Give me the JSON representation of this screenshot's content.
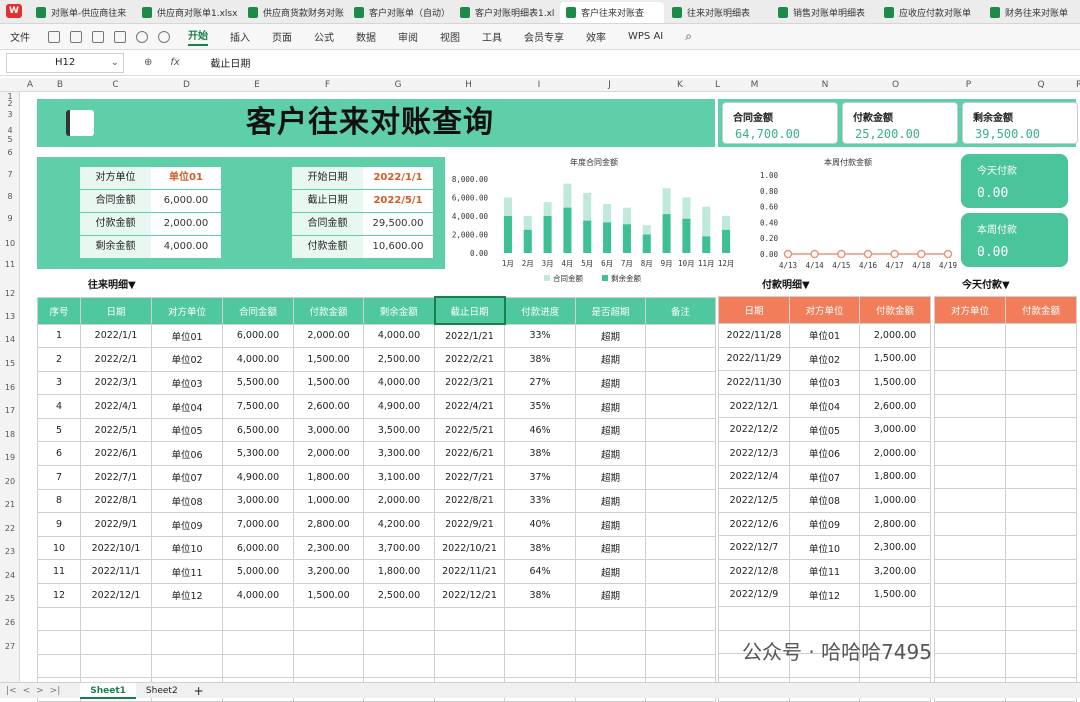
{
  "tabs": [
    {
      "label": "对账单-供应商往来"
    },
    {
      "label": "供应商对账单1.xlsx"
    },
    {
      "label": "供应商货款财务对账"
    },
    {
      "label": "客户对账单（自动）"
    },
    {
      "label": "客户对账明细表1.xl"
    },
    {
      "label": "客户往来对账查"
    },
    {
      "label": "往来对账明细表"
    },
    {
      "label": "销售对账单明细表"
    },
    {
      "label": "应收应付款对账单"
    },
    {
      "label": "财务往来对账单"
    }
  ],
  "ribbon": {
    "file": "文件",
    "items": [
      "开始",
      "插入",
      "页面",
      "公式",
      "数据",
      "审阅",
      "视图",
      "工具",
      "会员专享",
      "效率",
      "WPS AI"
    ],
    "active": "开始"
  },
  "formula_bar": {
    "cell": "H12",
    "content": "截止日期",
    "fx": "fx"
  },
  "columns": [
    "A",
    "B",
    "C",
    "D",
    "E",
    "F",
    "G",
    "H",
    "I",
    "J",
    "K",
    "L",
    "M",
    "N",
    "O",
    "P",
    "Q",
    "R"
  ],
  "rows": [
    "1",
    "2",
    "3",
    "4",
    "5",
    "6",
    "7",
    "8",
    "9",
    "10",
    "11",
    "12",
    "13",
    "14",
    "15",
    "16",
    "17",
    "18",
    "19",
    "20",
    "21",
    "22",
    "23",
    "24",
    "25",
    "26",
    "27"
  ],
  "banner": {
    "title": "客户往来对账查询"
  },
  "kpis": [
    {
      "label": "合同金额",
      "value": "64,700.00"
    },
    {
      "label": "付款金额",
      "value": "25,200.00"
    },
    {
      "label": "剩余金额",
      "value": "39,500.00"
    }
  ],
  "info": {
    "left": [
      {
        "label": "对方单位",
        "value": "单位01"
      },
      {
        "label": "合同金额",
        "value": "6,000.00"
      },
      {
        "label": "付款金额",
        "value": "2,000.00"
      },
      {
        "label": "剩余金额",
        "value": "4,000.00"
      }
    ],
    "right": [
      {
        "label": "开始日期",
        "value": "2022/1/1"
      },
      {
        "label": "截止日期",
        "value": "2022/5/1"
      },
      {
        "label": "合同金额",
        "value": "29,500.00"
      },
      {
        "label": "付款金额",
        "value": "10,600.00"
      }
    ]
  },
  "cards": [
    {
      "label": "今天付款",
      "value": "0.00"
    },
    {
      "label": "本周付款",
      "value": "0.00"
    }
  ],
  "chart_data": [
    {
      "type": "bar",
      "title": "年度合同金额",
      "categories": [
        "1月",
        "2月",
        "3月",
        "4月",
        "5月",
        "6月",
        "7月",
        "8月",
        "9月",
        "10月",
        "11月",
        "12月"
      ],
      "series": [
        {
          "name": "合同金额",
          "values": [
            6000,
            4000,
            5500,
            7500,
            6500,
            5300,
            4900,
            3000,
            7000,
            6000,
            5000,
            4000
          ],
          "color": "#bfe9da"
        },
        {
          "name": "剩余金额",
          "values": [
            4000,
            2500,
            4000,
            4900,
            3500,
            3300,
            3100,
            2000,
            4200,
            3700,
            1800,
            2500
          ],
          "color": "#3ebf95"
        }
      ],
      "ylim": [
        0,
        8000
      ],
      "yticks": [
        "8,000.00",
        "6,000.00",
        "4,000.00",
        "2,000.00",
        "0.00"
      ],
      "legend": "bottom"
    },
    {
      "type": "line",
      "title": "本周付款金额",
      "categories": [
        "4/13",
        "4/14",
        "4/15",
        "4/16",
        "4/17",
        "4/18",
        "4/19"
      ],
      "series": [
        {
          "values": [
            0,
            0,
            0,
            0,
            0,
            0,
            0
          ],
          "color": "#e8967a"
        }
      ],
      "ylim": [
        0,
        1
      ],
      "yticks": [
        "1.00",
        "0.80",
        "0.60",
        "0.40",
        "0.20",
        "0.00"
      ]
    }
  ],
  "sections": {
    "detail": "往来明细▼",
    "payment": "付款明细▼",
    "today": "今天付款▼"
  },
  "main_table": {
    "headers": [
      "序号",
      "日期",
      "对方单位",
      "合同金额",
      "付款金额",
      "剩余金额",
      "截止日期",
      "付款进度",
      "是否超期",
      "备注"
    ],
    "rows": [
      [
        "1",
        "2022/1/1",
        "单位01",
        "6,000.00",
        "2,000.00",
        "4,000.00",
        "2022/1/21",
        "33%",
        "超期",
        ""
      ],
      [
        "2",
        "2022/2/1",
        "单位02",
        "4,000.00",
        "1,500.00",
        "2,500.00",
        "2022/2/21",
        "38%",
        "超期",
        ""
      ],
      [
        "3",
        "2022/3/1",
        "单位03",
        "5,500.00",
        "1,500.00",
        "4,000.00",
        "2022/3/21",
        "27%",
        "超期",
        ""
      ],
      [
        "4",
        "2022/4/1",
        "单位04",
        "7,500.00",
        "2,600.00",
        "4,900.00",
        "2022/4/21",
        "35%",
        "超期",
        ""
      ],
      [
        "5",
        "2022/5/1",
        "单位05",
        "6,500.00",
        "3,000.00",
        "3,500.00",
        "2022/5/21",
        "46%",
        "超期",
        ""
      ],
      [
        "6",
        "2022/6/1",
        "单位06",
        "5,300.00",
        "2,000.00",
        "3,300.00",
        "2022/6/21",
        "38%",
        "超期",
        ""
      ],
      [
        "7",
        "2022/7/1",
        "单位07",
        "4,900.00",
        "1,800.00",
        "3,100.00",
        "2022/7/21",
        "37%",
        "超期",
        ""
      ],
      [
        "8",
        "2022/8/1",
        "单位08",
        "3,000.00",
        "1,000.00",
        "2,000.00",
        "2022/8/21",
        "33%",
        "超期",
        ""
      ],
      [
        "9",
        "2022/9/1",
        "单位09",
        "7,000.00",
        "2,800.00",
        "4,200.00",
        "2022/9/21",
        "40%",
        "超期",
        ""
      ],
      [
        "10",
        "2022/10/1",
        "单位10",
        "6,000.00",
        "2,300.00",
        "3,700.00",
        "2022/10/21",
        "38%",
        "超期",
        ""
      ],
      [
        "11",
        "2022/11/1",
        "单位11",
        "5,000.00",
        "3,200.00",
        "1,800.00",
        "2022/11/21",
        "64%",
        "超期",
        ""
      ],
      [
        "12",
        "2022/12/1",
        "单位12",
        "4,000.00",
        "1,500.00",
        "2,500.00",
        "2022/12/21",
        "38%",
        "超期",
        ""
      ]
    ]
  },
  "payment_table": {
    "headers": [
      "日期",
      "对方单位",
      "付款金额"
    ],
    "rows": [
      [
        "2022/11/28",
        "单位01",
        "2,000.00"
      ],
      [
        "2022/11/29",
        "单位02",
        "1,500.00"
      ],
      [
        "2022/11/30",
        "单位03",
        "1,500.00"
      ],
      [
        "2022/12/1",
        "单位04",
        "2,600.00"
      ],
      [
        "2022/12/2",
        "单位05",
        "3,000.00"
      ],
      [
        "2022/12/3",
        "单位06",
        "2,000.00"
      ],
      [
        "2022/12/4",
        "单位07",
        "1,800.00"
      ],
      [
        "2022/12/5",
        "单位08",
        "1,000.00"
      ],
      [
        "2022/12/6",
        "单位09",
        "2,800.00"
      ],
      [
        "2022/12/7",
        "单位10",
        "2,300.00"
      ],
      [
        "2022/12/8",
        "单位11",
        "3,200.00"
      ],
      [
        "2022/12/9",
        "单位12",
        "1,500.00"
      ]
    ]
  },
  "today_table": {
    "headers": [
      "对方单位",
      "付款金额"
    ]
  },
  "sheets": [
    "Sheet1",
    "Sheet2"
  ],
  "watermark": "公众号 · 哈哈哈7495"
}
